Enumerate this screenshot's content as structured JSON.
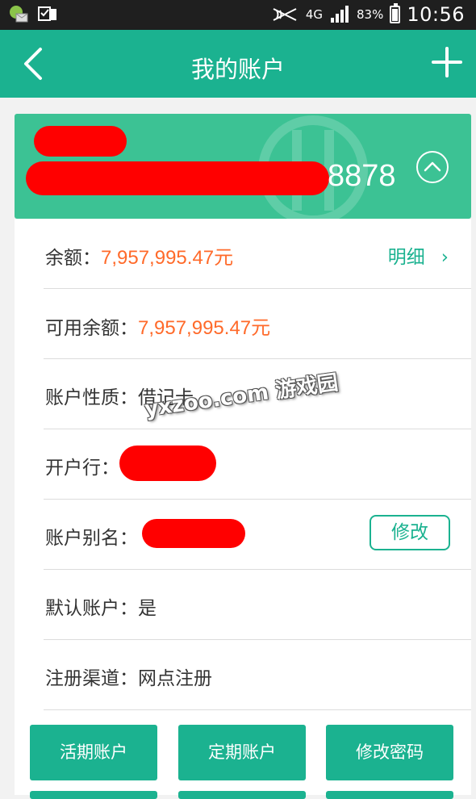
{
  "status_bar": {
    "network": "4G",
    "battery": "83%",
    "battery_level": 0.83,
    "time": "10:56"
  },
  "nav": {
    "title": "我的账户",
    "back_icon": "chevron-left-icon",
    "add_icon": "plus-icon"
  },
  "card": {
    "number_tail": "8878",
    "toggle_icon": "chevron-up-circle-icon"
  },
  "details": {
    "balance_label": "余额：",
    "balance_value": "7,957,995.47元",
    "detail_link": "明细",
    "detail_chevron": "›",
    "available_label": "可用余额：",
    "available_value": "7,957,995.47元",
    "account_type": "账户性质：借记卡",
    "bank_label": "开户行：",
    "alias_label": "账户别名：",
    "edit_label": "修改",
    "default_account": "默认账户：是",
    "register_channel": "注册渠道：网点注册"
  },
  "actions": {
    "current_account": "活期账户",
    "fixed_account": "定期账户",
    "change_password": "修改密码"
  },
  "watermark": "yxzoo.com 游戏园",
  "colors": {
    "primary": "#1bb290",
    "card": "#3cc294",
    "amount": "#ff6a2a",
    "redaction": "#ff0000"
  }
}
